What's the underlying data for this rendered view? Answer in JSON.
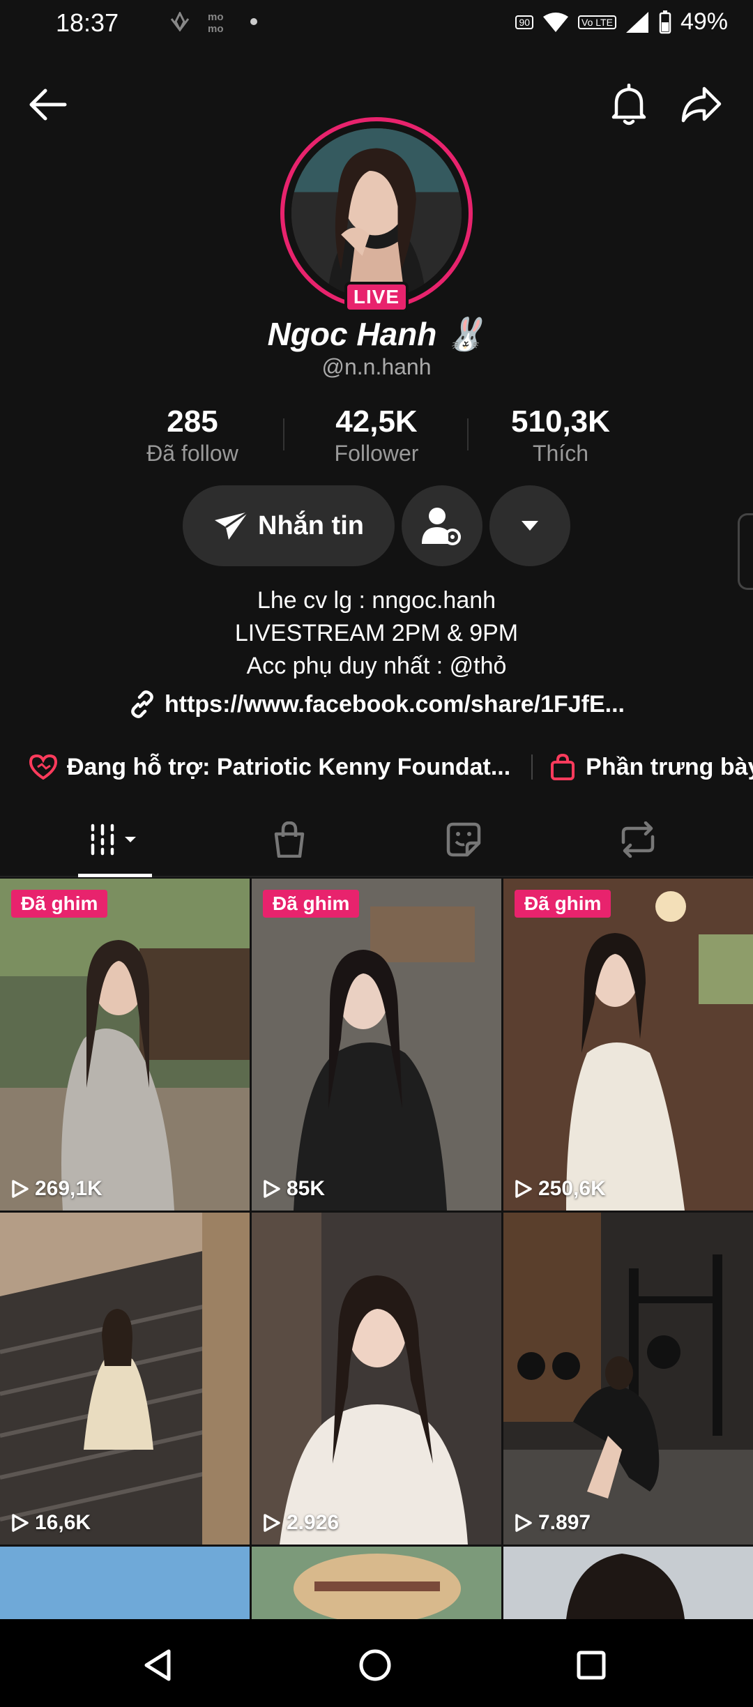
{
  "status": {
    "time": "18:37",
    "battery": "49%",
    "mini_badge_1": "90",
    "mini_badge_2": "Vo LTE"
  },
  "profile": {
    "name": "Ngoc Hanh 🐰",
    "handle": "@n.n.hanh",
    "live_label": "LIVE"
  },
  "stats": [
    {
      "value": "285",
      "label": "Đã follow"
    },
    {
      "value": "42,5K",
      "label": "Follower"
    },
    {
      "value": "510,3K",
      "label": "Thích"
    }
  ],
  "actions": {
    "message_label": "Nhắn tin"
  },
  "bio": {
    "line1": "Lhe cv lg : nngoc.hanh",
    "line2": "LIVESTREAM 2PM & 9PM",
    "line3": "Acc phụ duy nhất : @thỏ",
    "link": "https://www.facebook.com/share/1FJfE..."
  },
  "support": {
    "charity": "Đang hỗ trợ: Patriotic Kenny Foundat...",
    "showcase": "Phần trưng bày"
  },
  "tabs": [
    "videos-icon",
    "shop-icon",
    "stickers-icon",
    "repost-icon"
  ],
  "colors": {
    "accent": "#e8236d",
    "background": "#121212",
    "button_bg": "#2d2d2d"
  },
  "videos": [
    {
      "pinned": "Đã ghim",
      "views": "269,1K"
    },
    {
      "pinned": "Đã ghim",
      "views": "85K"
    },
    {
      "pinned": "Đã ghim",
      "views": "250,6K"
    },
    {
      "pinned": "",
      "views": "16,6K"
    },
    {
      "pinned": "",
      "views": "2.926"
    },
    {
      "pinned": "",
      "views": "7.897"
    }
  ]
}
